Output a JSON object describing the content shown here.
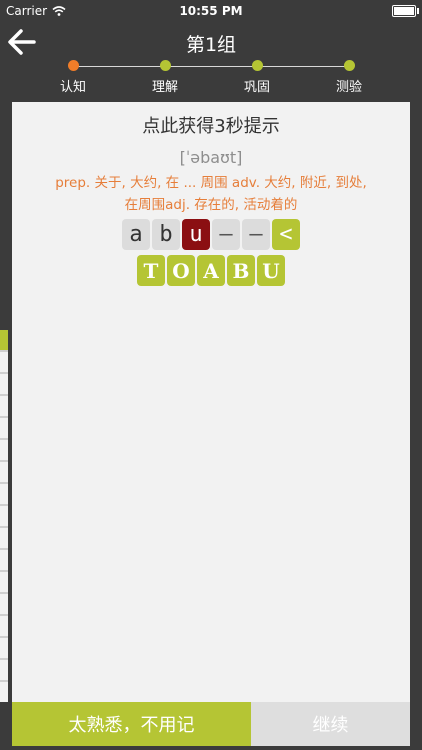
{
  "status": {
    "carrier": "Carrier",
    "time": "10:55 PM"
  },
  "nav": {
    "title": "第1组"
  },
  "steps": [
    {
      "label": "认知",
      "active": true
    },
    {
      "label": "理解",
      "active": false
    },
    {
      "label": "巩固",
      "active": false
    },
    {
      "label": "测验",
      "active": false
    }
  ],
  "card": {
    "hint": "点此获得3秒提示",
    "phonetic": "[ˈəbaʊt]",
    "definition_line1": "prep. 关于, 大约, 在 ... 周围 adv. 大约, 附近, 到处,",
    "definition_line2": "在周围adj. 存在的, 活动着的"
  },
  "answer": {
    "tiles": [
      "a",
      "b",
      "u",
      "–",
      "–"
    ],
    "delete": "<"
  },
  "letters": [
    "T",
    "O",
    "A",
    "B",
    "U"
  ],
  "footer": {
    "known": "太熟悉，不用记",
    "continue": "继续"
  },
  "colors": {
    "accent_green": "#b5c534",
    "active_orange": "#f07d29",
    "current_tile": "#8b0f12",
    "definition": "#e67e3a"
  }
}
